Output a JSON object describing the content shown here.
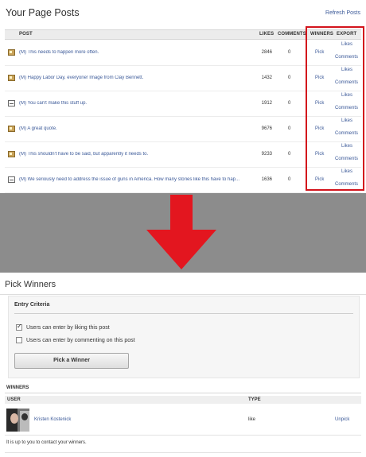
{
  "page_posts": {
    "title": "Your Page Posts",
    "refresh_label": "Refresh Posts",
    "columns": {
      "post": "POST",
      "likes": "LIKES",
      "comments": "COMMENTS",
      "winners": "WINNERS",
      "export": "EXPORT"
    },
    "rows": [
      {
        "icon": "photo-icon",
        "text": "(M) This needs to happen more often.",
        "likes": "2846",
        "comments": "0",
        "pick": "Pick",
        "export_likes": "Likes",
        "export_comments": "Comments"
      },
      {
        "icon": "photo-icon",
        "text": "(M) Happy Labor Day, everyone! Image from Clay Bennett.",
        "likes": "1432",
        "comments": "0",
        "pick": "Pick",
        "export_likes": "Likes",
        "export_comments": "Comments"
      },
      {
        "icon": "link-icon",
        "text": "(M) You can't make this stuff up.",
        "likes": "1912",
        "comments": "0",
        "pick": "Pick",
        "export_likes": "Likes",
        "export_comments": "Comments"
      },
      {
        "icon": "photo-icon",
        "text": "(M) A great quote.",
        "likes": "9676",
        "comments": "0",
        "pick": "Pick",
        "export_likes": "Likes",
        "export_comments": "Comments"
      },
      {
        "icon": "photo-icon",
        "text": "(M) This shouldn't have to be said, but apparently it needs to.",
        "likes": "9233",
        "comments": "0",
        "pick": "Pick",
        "export_likes": "Likes",
        "export_comments": "Comments"
      },
      {
        "icon": "link-icon",
        "text": "(M) We seriously need to address the issue of guns in America. How many stories like this have to hap...",
        "likes": "1636",
        "comments": "0",
        "pick": "Pick",
        "export_likes": "Likes",
        "export_comments": "Comments"
      }
    ]
  },
  "pick_winners": {
    "title": "Pick Winners",
    "criteria_title": "Entry Criteria",
    "criteria": [
      {
        "label": "Users can enter by liking this post",
        "checked": true
      },
      {
        "label": "Users can enter by commenting on this post",
        "checked": false
      }
    ],
    "button_label": "Pick a Winner",
    "winners_title": "WINNERS",
    "columns": {
      "user": "USER",
      "type": "TYPE"
    },
    "winners": [
      {
        "name": "Kristen Kostenick",
        "type": "like",
        "action": "Unpick"
      }
    ],
    "footnote": "It is up to you to contact your winners."
  },
  "colors": {
    "highlight": "#d3141c",
    "arrow": "#e3161f",
    "band": "#8c8c8c",
    "link": "#3b5998"
  }
}
